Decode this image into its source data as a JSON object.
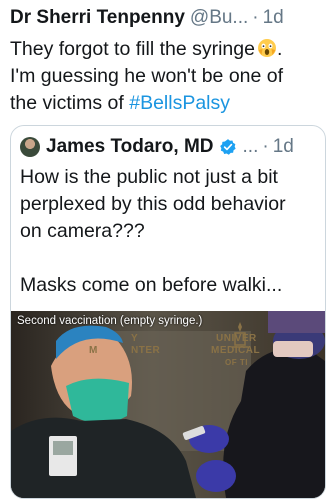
{
  "tweet": {
    "author_name": "Dr Sherri Tenpenny",
    "handle": "@Bu...",
    "separator": "·",
    "time": "1d",
    "text_line1": "They forgot to fill the syringe",
    "text_line2": "I'm guessing he won't be one of",
    "text_line3_prefix": "the victims of",
    "hashtag": "#BellsPalsy",
    "emoji": "screaming-face-icon"
  },
  "quote": {
    "author_name": "James Todaro, MD",
    "verified": true,
    "ellipsis": "...",
    "separator": "·",
    "time": "1d",
    "text_line1": "How is the public not just a bit",
    "text_line2": "perplexed by this odd behavior",
    "text_line3": "on camera???",
    "text_line4": "Masks come on before walki...",
    "media": {
      "caption": "Second vaccination (empty syringe.)",
      "wall_text_left_1": "Y",
      "wall_text_left_2": "M",
      "wall_text_left_3": "NTER",
      "wall_text_right_1": "UNIVER",
      "wall_text_right_2": "MEDICAL",
      "wall_text_right_3": "OF TI"
    }
  },
  "colors": {
    "text": "#14171a",
    "muted": "#657786",
    "link": "#1b95e0",
    "border": "#ccd6dd",
    "mask": "#2fb89a",
    "glove": "#3b3aa8"
  }
}
